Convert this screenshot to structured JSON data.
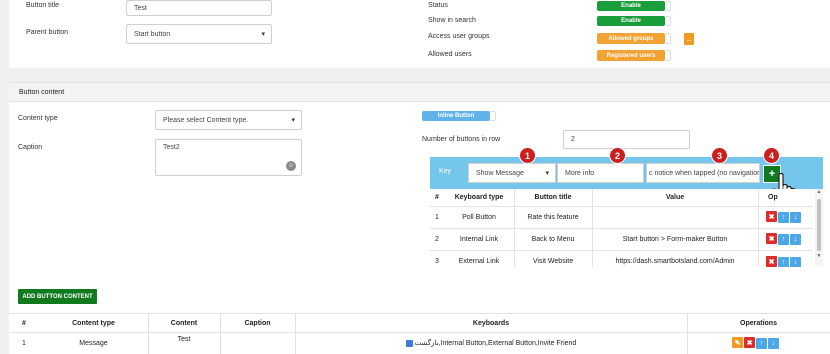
{
  "top_form": {
    "button_title_label": "Button title",
    "button_title_value": "Test",
    "parent_button_label": "Parent button",
    "parent_button_value": "Start button",
    "status_label": "Status",
    "status_value": "Enable",
    "show_in_search_label": "Show in search",
    "show_in_search_value": "Enable",
    "access_groups_label": "Access user groups",
    "access_groups_value": "Allowed groups",
    "access_groups_more": "..",
    "allowed_users_label": "Allowed users",
    "allowed_users_value": "Registered users"
  },
  "content_section": {
    "header": "Button content",
    "content_type_label": "Content type",
    "content_type_placeholder": "Please select Content type.",
    "caption_label": "Caption",
    "caption_value": "Test2",
    "inline_toggle": "Inline Button",
    "num_buttons_label": "Number of buttons in row",
    "num_buttons_value": "2"
  },
  "keyboard_editor": {
    "key_label": "Key",
    "action_select": "Show Message",
    "title_input": "More info",
    "value_input": "c notice when tapped (no navigation).",
    "add_icon": "+",
    "badges": [
      "1",
      "2",
      "3",
      "4"
    ],
    "columns": [
      "#",
      "Keyboard type",
      "Button title",
      "Value",
      "Op"
    ],
    "rows": [
      {
        "n": "1",
        "type": "Poll Button",
        "title": "Rate this feature",
        "value": ""
      },
      {
        "n": "2",
        "type": "Internal Link",
        "title": "Back to Menu",
        "value": "Start button > Form-maker Button"
      },
      {
        "n": "3",
        "type": "External Link",
        "title": "Visit Website",
        "value": "https://dash.smartbotsland.com/Admin"
      }
    ]
  },
  "add_content_button": "ADD BUTTON CONTENT",
  "content_table": {
    "columns": [
      "#",
      "Content type",
      "Content",
      "Caption",
      "Keyboards",
      "Operations"
    ],
    "rows": [
      {
        "n": "1",
        "type": "Message",
        "content": "Test",
        "caption": "",
        "keyboards": "بازگشت,Internal Button,External Button,Invite Friend"
      }
    ]
  },
  "colors": {
    "green": "#1a9e3b",
    "orange": "#f2a232",
    "light_blue": "#74c6ea",
    "red": "#e02b2b",
    "dark_green_button": "#117a1f"
  }
}
